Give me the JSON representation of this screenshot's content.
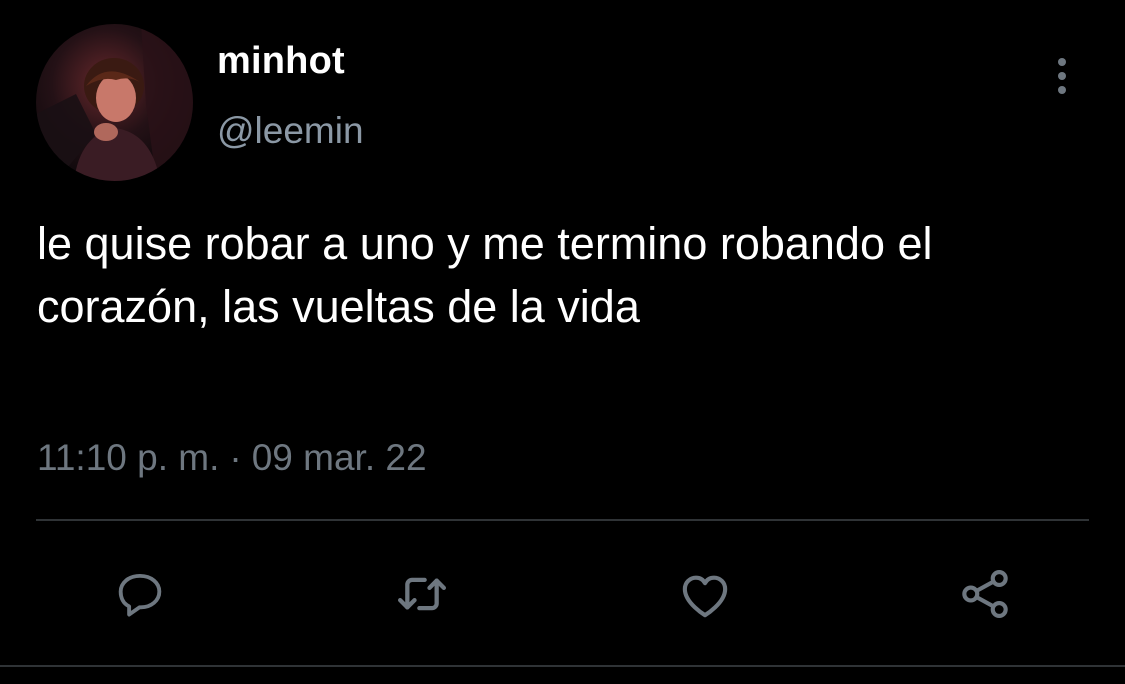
{
  "user": {
    "display_name": "minhot",
    "handle": "@leemin",
    "avatar_icon": "profile-photo"
  },
  "tweet": {
    "text": "le quise robar a uno y me termino robando el corazón, las vueltas de la vida",
    "time": "11:10 p. m.",
    "separator": "·",
    "date": "09 mar. 22"
  },
  "actions": [
    {
      "name": "reply",
      "icon": "speech-bubble-icon"
    },
    {
      "name": "retweet",
      "icon": "retweet-icon"
    },
    {
      "name": "like",
      "icon": "heart-icon"
    },
    {
      "name": "share",
      "icon": "share-icon"
    }
  ],
  "colors": {
    "background": "#000000",
    "primary_text": "#ffffff",
    "secondary_text": "#8b98a5",
    "icon": "#6e7780",
    "divider": "#2f3336"
  }
}
